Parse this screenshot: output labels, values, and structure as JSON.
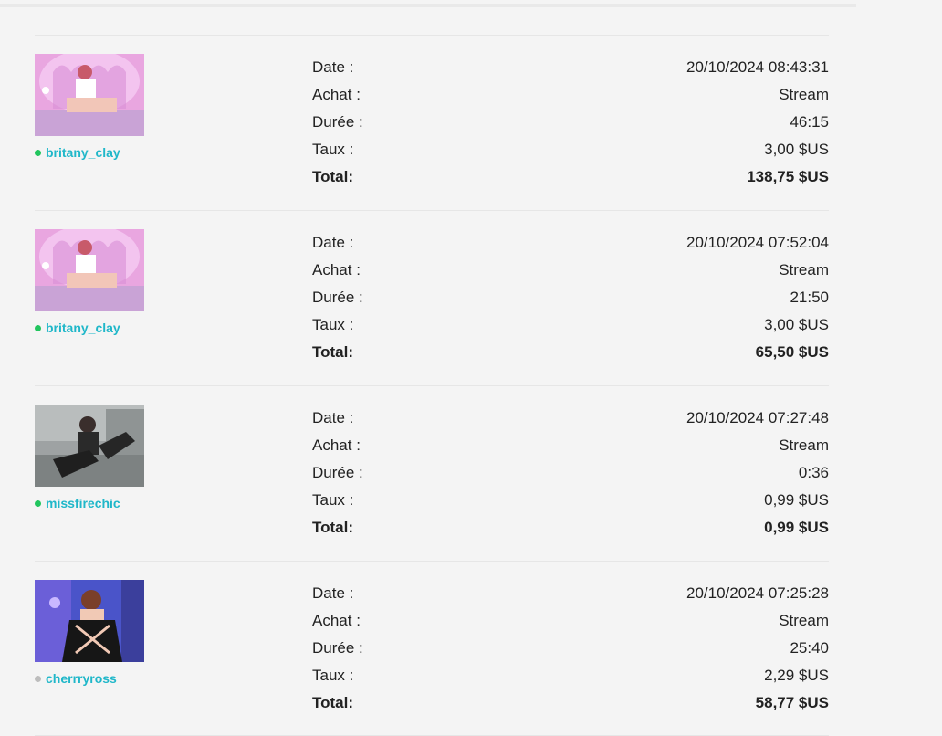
{
  "labels": {
    "date": "Date :",
    "purchase": "Achat :",
    "duration": "Durée :",
    "rate": "Taux :",
    "total": "Total:"
  },
  "colors": {
    "online": "#22c55e",
    "offline": "#bdbdbd",
    "username": "#1fb7c9"
  },
  "transactions": [
    {
      "username": "britany_clay",
      "status": "online",
      "date": "20/10/2024 08:43:31",
      "purchase": "Stream",
      "duration": "46:15",
      "rate": "3,00 $US",
      "total": "138,75 $US",
      "thumbnail": "pink-room"
    },
    {
      "username": "britany_clay",
      "status": "online",
      "date": "20/10/2024 07:52:04",
      "purchase": "Stream",
      "duration": "21:50",
      "rate": "3,00 $US",
      "total": "65,50 $US",
      "thumbnail": "pink-room"
    },
    {
      "username": "missfirechic",
      "status": "online",
      "date": "20/10/2024 07:27:48",
      "purchase": "Stream",
      "duration": "0:36",
      "rate": "0,99 $US",
      "total": "0,99 $US",
      "thumbnail": "grey-sofa"
    },
    {
      "username": "cherrryross",
      "status": "offline",
      "date": "20/10/2024 07:25:28",
      "purchase": "Stream",
      "duration": "25:40",
      "rate": "2,29 $US",
      "total": "58,77 $US",
      "thumbnail": "blue-light"
    }
  ]
}
